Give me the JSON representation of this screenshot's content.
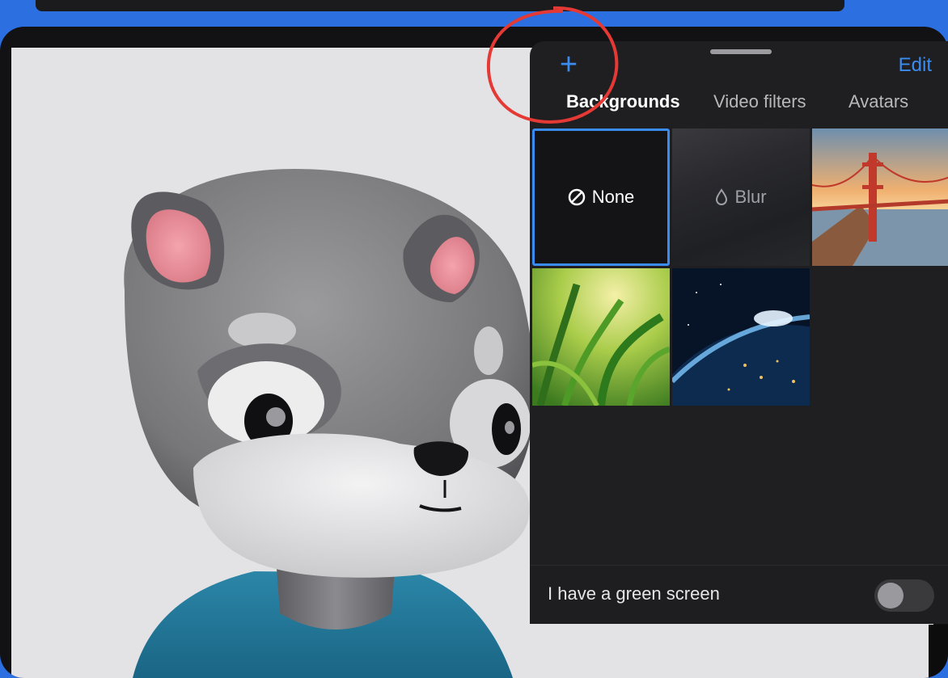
{
  "panel": {
    "add_label": "+",
    "edit_label": "Edit",
    "tabs": [
      {
        "label": "Backgrounds",
        "active": true
      },
      {
        "label": "Video filters",
        "active": false
      },
      {
        "label": "Avatars",
        "active": false
      }
    ],
    "tiles": [
      {
        "label": "None",
        "icon": "no-entry-icon",
        "selected": true
      },
      {
        "label": "Blur",
        "icon": "droplet-icon",
        "selected": false
      },
      {
        "label": "",
        "image": "golden-gate-bridge-sunset",
        "selected": false
      },
      {
        "label": "",
        "image": "green-grass",
        "selected": false
      },
      {
        "label": "",
        "image": "earth-from-space",
        "selected": false
      }
    ],
    "green_screen": {
      "label": "I have a green screen",
      "enabled": false
    }
  },
  "colors": {
    "frame": "#2b6fe0",
    "accent": "#3b8cf0",
    "annotation": "#e53935",
    "panel_bg": "#1f1f21"
  }
}
